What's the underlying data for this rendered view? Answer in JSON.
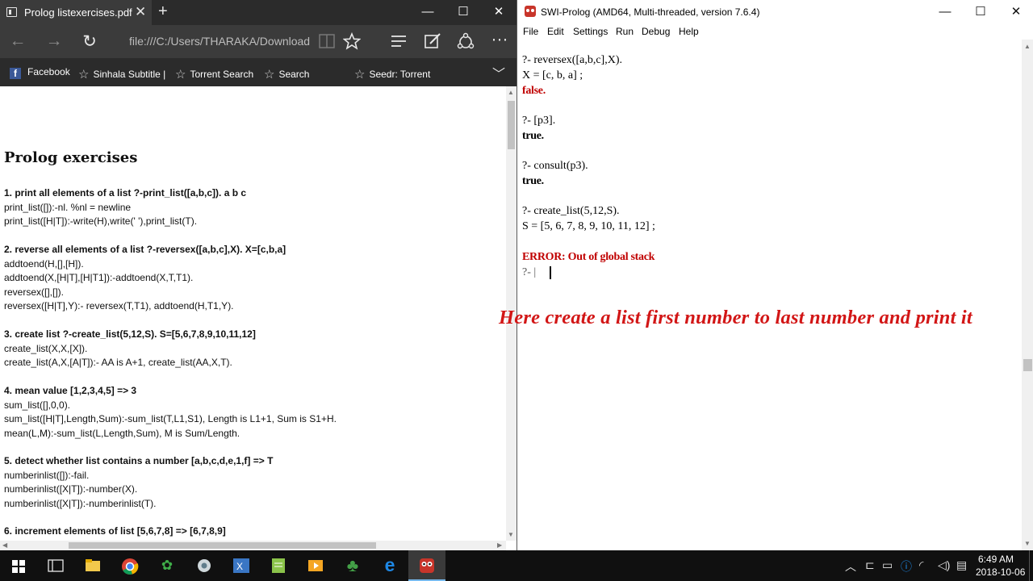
{
  "edge": {
    "tab_title": "Prolog listexercises.pdf",
    "tab_close": "✕",
    "new_tab": "+",
    "window_controls": {
      "minimize": "—",
      "maximize": "☐",
      "close": "✕"
    },
    "nav": {
      "back": "←",
      "forward": "→",
      "refresh": "↻",
      "address": "file:///C:/Users/THARAKA/Downloads/Dc",
      "more": "···"
    },
    "favorites": [
      {
        "label": "Facebook",
        "icon": "facebook-icon"
      },
      {
        "label": "Sinhala Subtitle |",
        "icon": "star-icon"
      },
      {
        "label": "Torrent Search",
        "icon": "star-icon"
      },
      {
        "label": "Search",
        "icon": "star-icon"
      },
      {
        "label": "Seedr: Torrent",
        "icon": "star-icon"
      }
    ],
    "favorites_chevron": "﹀"
  },
  "pdf": {
    "title": "Prolog exercises",
    "exercises": [
      {
        "heading": "1. print all elements of a list ?-print_list([a,b,c]). a b c",
        "lines": [
          "print_list([]):-nl. %nl = newline",
          "print_list([H|T]):-write(H),write(' '),print_list(T)."
        ]
      },
      {
        "heading": "2. reverse all elements of a list ?-reversex([a,b,c],X). X=[c,b,a]",
        "lines": [
          "addtoend(H,[],[H]).",
          "addtoend(X,[H|T],[H|T1]):-addtoend(X,T,T1).",
          "reversex([],[]).",
          "reversex([H|T],Y):- reversex(T,T1), addtoend(H,T1,Y)."
        ]
      },
      {
        "heading": "3. create list ?-create_list(5,12,S). S=[5,6,7,8,9,10,11,12]",
        "lines": [
          "create_list(X,X,[X]).",
          "create_list(A,X,[A|T]):- AA is A+1, create_list(AA,X,T)."
        ]
      },
      {
        "heading": "4. mean value [1,2,3,4,5] => 3",
        "lines": [
          "sum_list([],0,0).",
          "sum_list([H|T],Length,Sum):-sum_list(T,L1,S1), Length is L1+1, Sum is S1+H.",
          "mean(L,M):-sum_list(L,Length,Sum), M is Sum/Length."
        ]
      },
      {
        "heading": "5. detect whether list contains a number [a,b,c,d,e,1,f] => T",
        "lines": [
          "numberinlist([]):-fail.",
          "numberinlist([X|T]):-number(X).",
          "numberinlist([X|T]):-numberinlist(T)."
        ]
      },
      {
        "heading": "6. increment elements of list [5,6,7,8] => [6,7,8,9]",
        "lines": []
      }
    ]
  },
  "swi": {
    "title": "SWI-Prolog (AMD64, Multi-threaded, version 7.6.4)",
    "menu": [
      "File",
      "Edit",
      "Settings",
      "Run",
      "Debug",
      "Help"
    ],
    "console": {
      "l1": "?- reversex([a,b,c],X).",
      "l2": "X = [c, b, a] ;",
      "l3": "false.",
      "l4": "?- [p3].",
      "l5": "true.",
      "l6": "?- consult(p3).",
      "l7": "true.",
      "l8": "?- create_list(5,12,S).",
      "l9": "S = [5, 6, 7, 8, 9, 10, 11, 12] ;",
      "l10": "ERROR: Out of global stack",
      "l11": "?- |"
    }
  },
  "annotation": "Here create a list first number to last number and print it",
  "taskbar": {
    "time": "6:49 AM",
    "date": "2018-10-06",
    "apps": [
      "start",
      "task-view",
      "file-explorer",
      "chrome",
      "app-5",
      "app-6",
      "app-7",
      "app-8",
      "app-9",
      "edge",
      "swi-prolog"
    ]
  },
  "colors": {
    "edge_chrome": "#2b2b2b",
    "edge_nav": "#3b3b3b",
    "error_red": "#c00000",
    "annotation_red": "#d21616",
    "taskbar": "#101010"
  }
}
